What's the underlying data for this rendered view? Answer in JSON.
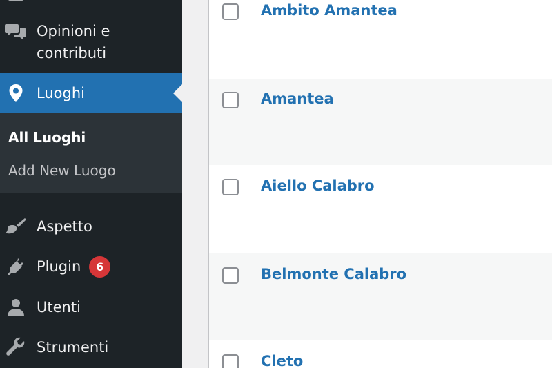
{
  "sidebar": {
    "items": [
      {
        "label": "Opinioni e contributi",
        "line1": "Opinioni e",
        "line2": "contributi",
        "icon": "comments-icon"
      },
      {
        "label": "Luoghi",
        "icon": "location-pin-icon",
        "active": true
      },
      {
        "label": "Aspetto",
        "icon": "paintbrush-icon"
      },
      {
        "label": "Plugin",
        "icon": "plugin-icon",
        "badge": "6"
      },
      {
        "label": "Utenti",
        "icon": "users-icon"
      },
      {
        "label": "Strumenti",
        "icon": "wrench-icon"
      }
    ],
    "submenu": [
      {
        "label": "All Luoghi",
        "current": true
      },
      {
        "label": "Add New Luogo",
        "current": false
      }
    ]
  },
  "list": {
    "rows": [
      {
        "title": "Ambito Amantea"
      },
      {
        "title": "Amantea"
      },
      {
        "title": "Aiello Calabro"
      },
      {
        "title": "Belmonte Calabro"
      },
      {
        "title": "Cleto"
      }
    ]
  },
  "colors": {
    "sidebar_bg": "#1d2327",
    "submenu_bg": "#2c3338",
    "active_bg": "#2271b1",
    "badge_bg": "#d63638",
    "link": "#2271b1"
  }
}
